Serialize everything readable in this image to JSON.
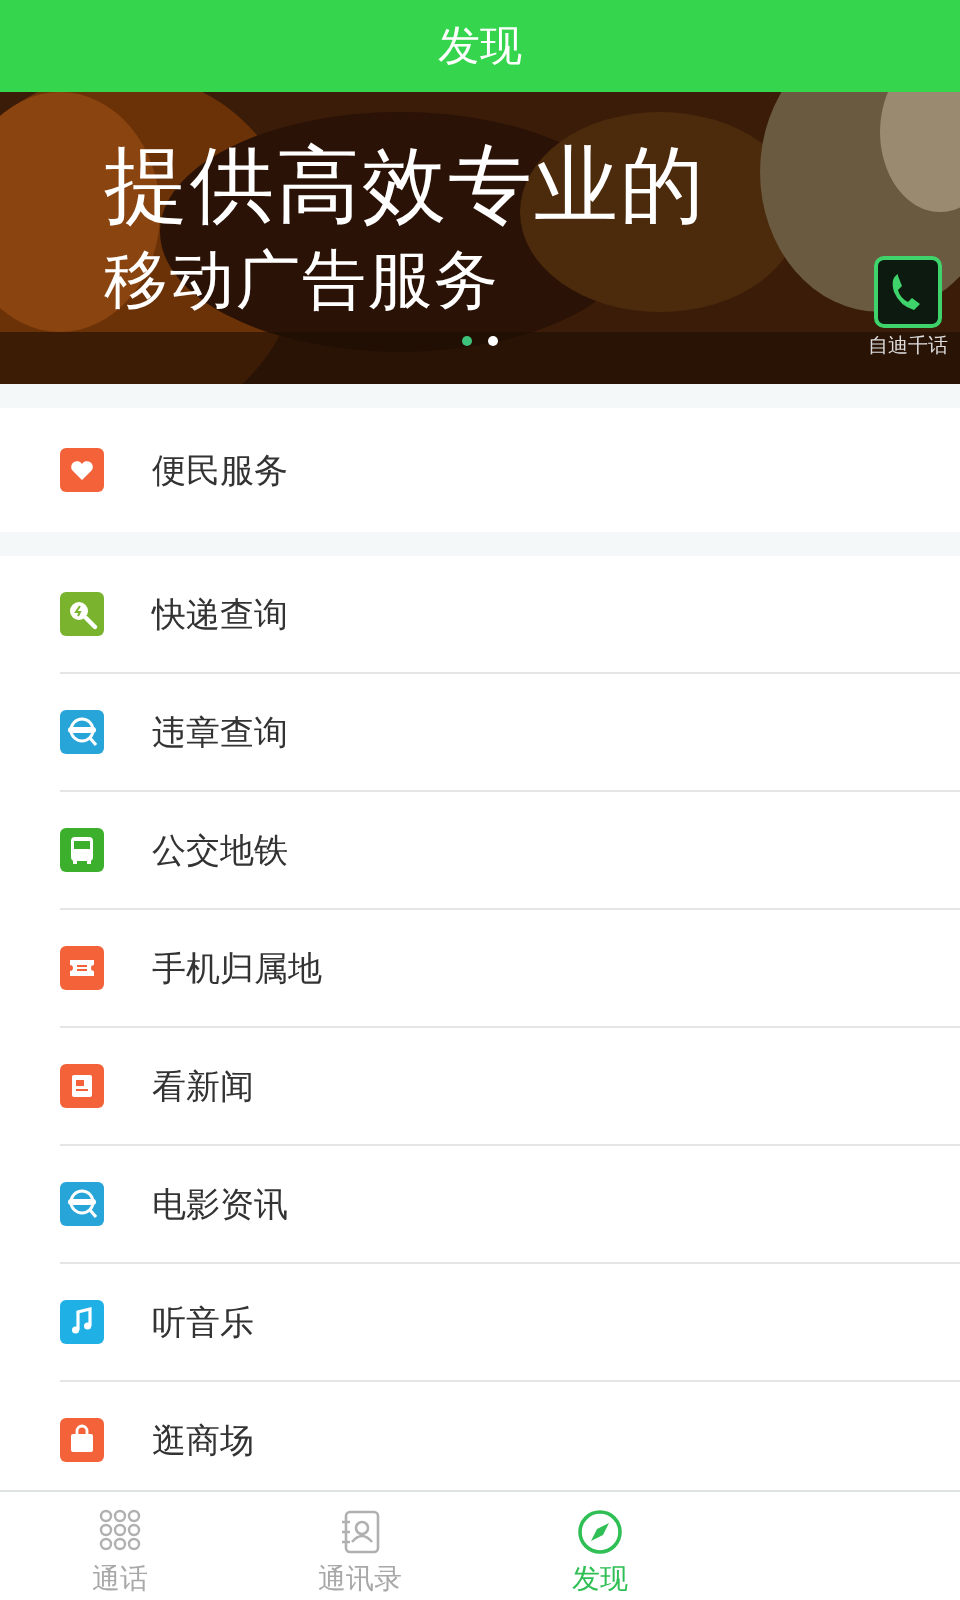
{
  "header": {
    "title": "发现"
  },
  "banner": {
    "kind": "picture",
    "headline": "提供高效专业的",
    "subline": "移动广告服务",
    "logo_caption": "自迪千话",
    "dots": [
      {
        "selected": true
      },
      {
        "selected": false
      }
    ]
  },
  "groups": [
    {
      "items": [
        {
          "label": "便民服务",
          "kind": "heart",
          "color": "#f4623a"
        }
      ]
    },
    {
      "items": [
        {
          "label": "快递查询",
          "kind": "search",
          "color": "#7ab32e"
        },
        {
          "label": "违章查询",
          "kind": "scan",
          "color": "#27a4d8"
        },
        {
          "label": "公交地铁",
          "kind": "bus",
          "color": "#3cb02c"
        },
        {
          "label": "手机归属地",
          "kind": "ticket",
          "color": "#f4623a"
        },
        {
          "label": "看新闻",
          "kind": "news",
          "color": "#f4623a"
        },
        {
          "label": "电影资讯",
          "kind": "scan",
          "color": "#27a4d8"
        },
        {
          "label": "听音乐",
          "kind": "music",
          "color": "#1fb0e6"
        },
        {
          "label": "逛商场",
          "kind": "bag",
          "color": "#f4623a"
        }
      ]
    }
  ],
  "tabs": [
    {
      "label": "通话",
      "kind": "dialpad",
      "selected": false
    },
    {
      "label": "通讯录",
      "kind": "contacts",
      "selected": false
    },
    {
      "label": "发现",
      "kind": "compass",
      "selected": true
    }
  ]
}
